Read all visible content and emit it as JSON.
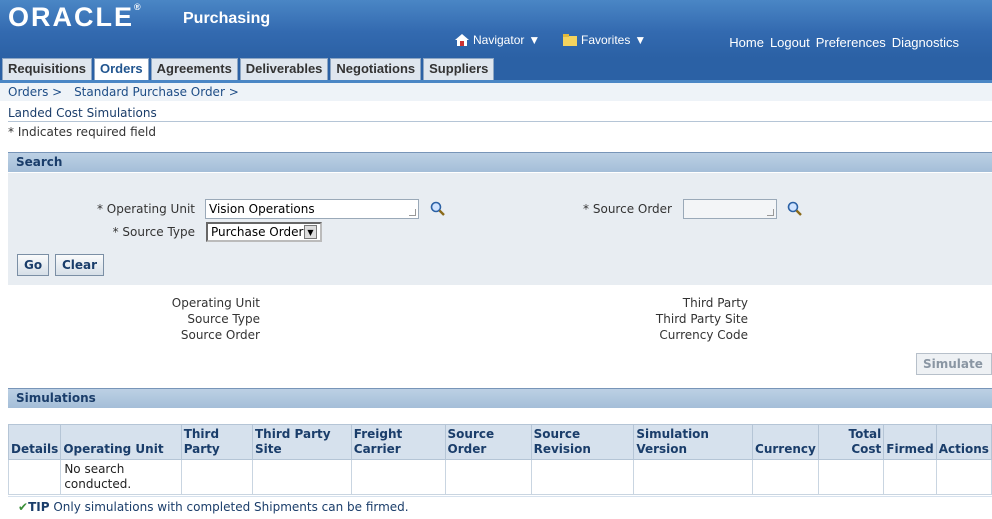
{
  "header": {
    "logo": "ORACLE",
    "app_title": "Purchasing",
    "navigator": "Navigator",
    "favorites": "Favorites",
    "links": [
      "Home",
      "Logout",
      "Preferences",
      "Diagnostics"
    ]
  },
  "tabs": [
    "Requisitions",
    "Orders",
    "Agreements",
    "Deliverables",
    "Negotiations",
    "Suppliers"
  ],
  "active_tab": "Orders",
  "breadcrumb": [
    "Orders >",
    "Standard Purchase Order >"
  ],
  "page_title": "Landed Cost Simulations",
  "required_note": "* Indicates required field",
  "search": {
    "heading": "Search",
    "operating_unit_label": "* Operating Unit",
    "operating_unit_value": "Vision Operations",
    "source_type_label": "* Source Type",
    "source_type_value": "Purchase Order",
    "source_order_label": "* Source Order",
    "source_order_value": "",
    "go": "Go",
    "clear": "Clear"
  },
  "info_left": [
    "Operating Unit",
    "Source Type",
    "Source Order"
  ],
  "info_right": [
    "Third Party",
    "Third Party Site",
    "Currency Code"
  ],
  "simulate": "Simulate",
  "simulations": {
    "heading": "Simulations",
    "columns": [
      "Details",
      "Operating Unit",
      "Third Party",
      "Third Party Site",
      "Freight Carrier",
      "Source Order",
      "Source Revision",
      "Simulation Version",
      "Currency",
      "Total Cost",
      "Firmed",
      "Actions"
    ],
    "empty_message": "No search conducted."
  },
  "tip": {
    "label": "TIP",
    "text": "Only simulations with completed Shipments can be firmed."
  },
  "colors": {
    "header_blue": "#336ab0",
    "section_blue": "#a4bed8",
    "text_blue": "#1a3d6a"
  }
}
